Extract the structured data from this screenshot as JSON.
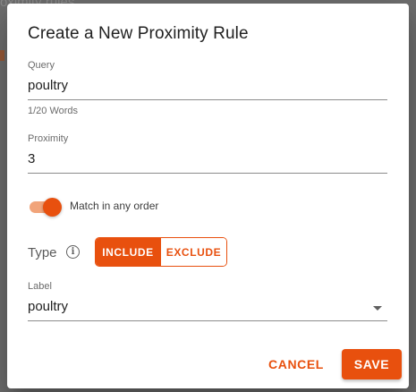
{
  "background": {
    "page_title_fragment": "oximity rules"
  },
  "dialog": {
    "title": "Create a New Proximity Rule",
    "query": {
      "label": "Query",
      "value": "poultry",
      "helper": "1/20 Words"
    },
    "proximity": {
      "label": "Proximity",
      "value": "3"
    },
    "match_any_order": {
      "label": "Match in any order",
      "checked": true
    },
    "type": {
      "label": "Type",
      "info_icon": "info-icon",
      "options": [
        "INCLUDE",
        "EXCLUDE"
      ],
      "selected": "INCLUDE"
    },
    "label_field": {
      "label": "Label",
      "value": "poultry"
    },
    "actions": {
      "cancel": "CANCEL",
      "save": "SAVE"
    }
  },
  "colors": {
    "accent": "#e8500e",
    "accent_light": "#f1a47a",
    "overlay": "#6f6f6f"
  }
}
